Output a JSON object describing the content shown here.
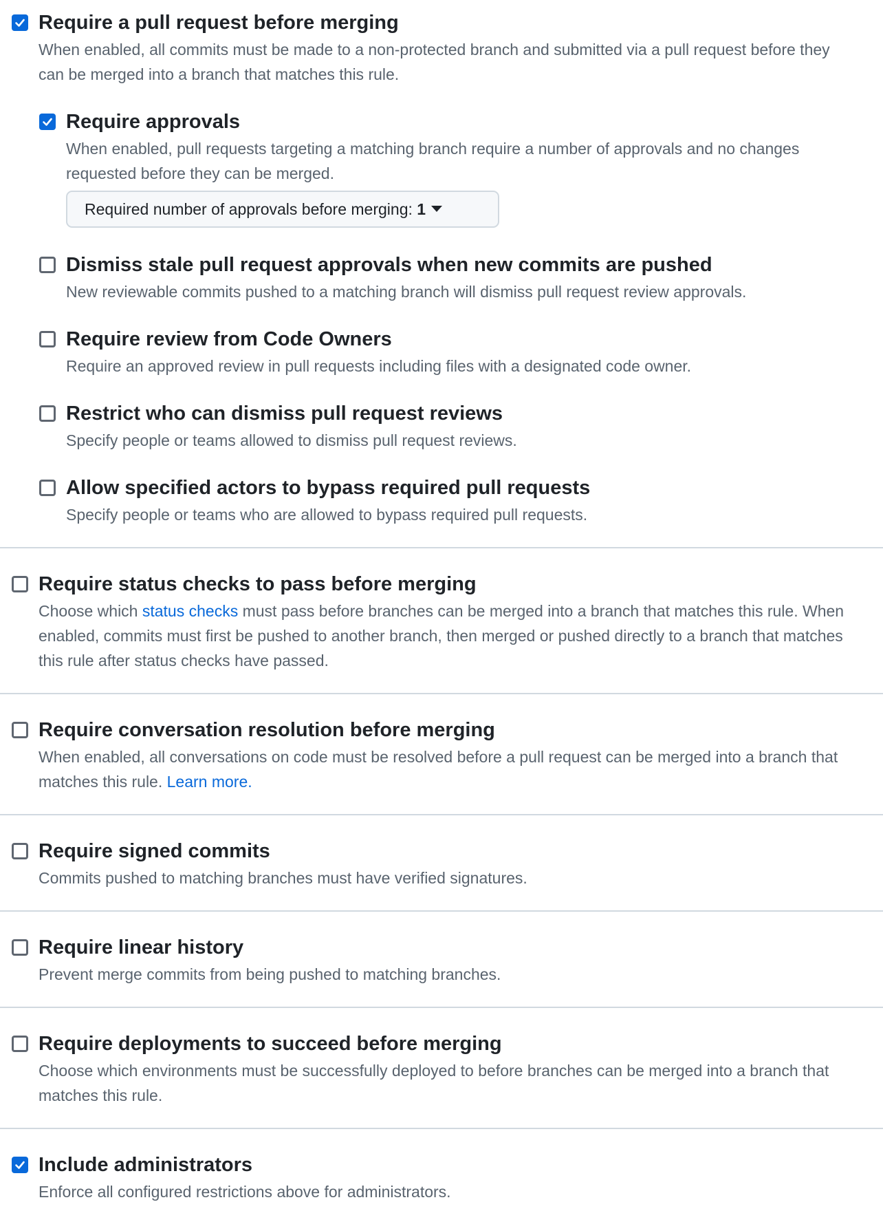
{
  "sections": {
    "pull_request": {
      "title": "Require a pull request before merging",
      "checked": true,
      "description": "When enabled, all commits must be made to a non-protected branch and submitted via a pull request before they can be merged into a branch that matches this rule.",
      "approvals": {
        "title": "Require approvals",
        "checked": true,
        "description": "When enabled, pull requests targeting a matching branch require a number of approvals and no changes requested before they can be merged.",
        "select_label": "Required number of approvals before merging:",
        "select_value": "1"
      },
      "dismiss_stale": {
        "title": "Dismiss stale pull request approvals when new commits are pushed",
        "checked": false,
        "description": "New reviewable commits pushed to a matching branch will dismiss pull request review approvals."
      },
      "code_owners": {
        "title": "Require review from Code Owners",
        "checked": false,
        "description": "Require an approved review in pull requests including files with a designated code owner."
      },
      "restrict_dismiss": {
        "title": "Restrict who can dismiss pull request reviews",
        "checked": false,
        "description": "Specify people or teams allowed to dismiss pull request reviews."
      },
      "bypass": {
        "title": "Allow specified actors to bypass required pull requests",
        "checked": false,
        "description": "Specify people or teams who are allowed to bypass required pull requests."
      }
    },
    "status_checks": {
      "title": "Require status checks to pass before merging",
      "checked": false,
      "description_before": "Choose which",
      "link": "status checks",
      "description_after": "must pass before branches can be merged into a branch that matches this rule. When enabled, commits must first be pushed to another branch, then merged or pushed directly to a branch that matches this rule after status checks have passed."
    },
    "conversation": {
      "title": "Require conversation resolution before merging",
      "checked": false,
      "description": "When enabled, all conversations on code must be resolved before a pull request can be merged into a branch that matches this rule.",
      "link": "Learn more",
      "link_suffix": "."
    },
    "signed_commits": {
      "title": "Require signed commits",
      "checked": false,
      "description": "Commits pushed to matching branches must have verified signatures."
    },
    "linear_history": {
      "title": "Require linear history",
      "checked": false,
      "description": "Prevent merge commits from being pushed to matching branches."
    },
    "deployments": {
      "title": "Require deployments to succeed before merging",
      "checked": false,
      "description": "Choose which environments must be successfully deployed to before branches can be merged into a branch that matches this rule."
    },
    "administrators": {
      "title": "Include administrators",
      "checked": true,
      "description": "Enforce all configured restrictions above for administrators."
    }
  },
  "colors": {
    "accent": "#0969da",
    "text_primary": "#1f2328",
    "text_muted": "#59636e",
    "border": "#d1d9e0"
  }
}
